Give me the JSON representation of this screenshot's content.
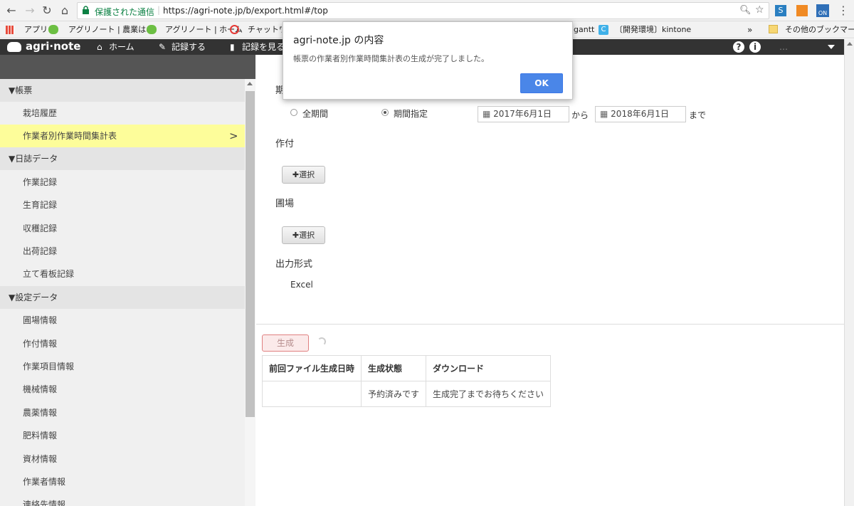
{
  "browser": {
    "secure_label": "保護された通信",
    "url": "https://agri-note.jp/b/export.html#/top",
    "bookmarks": [
      "アプリ",
      "アグリノート | 農業は、",
      "アグリノート | ホーム",
      "チャットワーク",
      "gantt",
      "〔開発環境〕kintone"
    ],
    "more_label": "»",
    "other_bookmarks": "その他のブックマーク"
  },
  "header": {
    "logo": "agri·note",
    "nav": [
      "ホーム",
      "記録する",
      "記録を見る"
    ],
    "user_name": "…"
  },
  "sidebar": {
    "sections": [
      {
        "label": "▼帳票",
        "items": [
          "栽培履歴",
          "作業者別作業時間集計表"
        ]
      },
      {
        "label": "▼日誌データ",
        "items": [
          "作業記録",
          "生育記録",
          "収穫記録",
          "出荷記録",
          "立て看板記録"
        ]
      },
      {
        "label": "▼設定データ",
        "items": [
          "圃場情報",
          "作付情報",
          "作業項目情報",
          "機械情報",
          "農薬情報",
          "肥料情報",
          "資材情報",
          "作業者情報",
          "連絡先情報"
        ]
      }
    ],
    "active_item": "作業者別作業時間集計表",
    "active_arrow": ">"
  },
  "form": {
    "period_label": "期間",
    "radio_all": "全期間",
    "radio_range": "期間指定",
    "selected_radio": "期間指定",
    "date_from": "2017年6月1日",
    "kara": "から",
    "date_to": "2018年6月1日",
    "made": "まで",
    "crop_label": "作付",
    "field_label": "圃場",
    "select_btn": "選択",
    "output_label": "出力形式",
    "output_value": "Excel"
  },
  "generate_btn": "生成",
  "table": {
    "headers": [
      "前回ファイル生成日時",
      "生成状態",
      "ダウンロード"
    ],
    "row": [
      "",
      "予約済みです",
      "生成完了までお待ちください"
    ]
  },
  "dialog": {
    "title": "agri-note.jp の内容",
    "message": "帳票の作業者別作業時間集計表の生成が完了しました。",
    "ok": "OK"
  },
  "colors": {
    "active_item": "#fdfd9a",
    "header": "#333333",
    "ok_button": "#4a86e8",
    "generate_border": "#e08080"
  }
}
